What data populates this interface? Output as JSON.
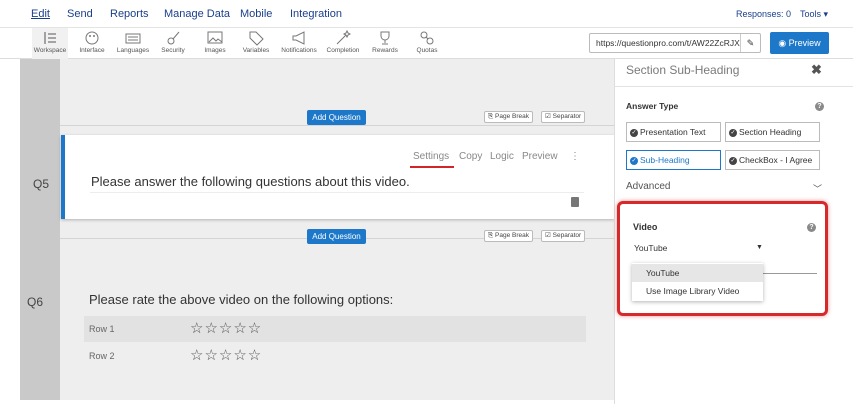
{
  "menu": {
    "items": [
      "Edit",
      "Send",
      "Reports",
      "Manage Data",
      "Mobile",
      "Integration"
    ],
    "responses": "Responses: 0",
    "tools": "Tools ▾"
  },
  "toolbar": {
    "tools": [
      {
        "label": "Workspace",
        "icon": "workspace-icon"
      },
      {
        "label": "Interface",
        "icon": "palette-icon"
      },
      {
        "label": "Languages",
        "icon": "keyboard-icon"
      },
      {
        "label": "Security",
        "icon": "guitar-icon"
      },
      {
        "label": "Images",
        "icon": "image-icon"
      },
      {
        "label": "Variables",
        "icon": "tag-icon"
      },
      {
        "label": "Notifications",
        "icon": "megaphone-icon"
      },
      {
        "label": "Completion",
        "icon": "magic-wand-icon"
      },
      {
        "label": "Rewards",
        "icon": "trophy-icon"
      },
      {
        "label": "Quotas",
        "icon": "quota-icon"
      }
    ],
    "url": "https://questionpro.com/t/AW22ZcRJX",
    "preview": "◉ Preview"
  },
  "canvas": {
    "add_question": "Add Question",
    "page_break": "Page Break",
    "separator": "Separator",
    "q5": {
      "number": "Q5",
      "text": "Please answer the following questions about this video.",
      "actions": [
        "Settings",
        "Copy",
        "Logic",
        "Preview",
        "⋮"
      ]
    },
    "q6": {
      "number": "Q6",
      "text": "Please rate the above video on the following options:",
      "rows": [
        {
          "label": "Row 1",
          "stars": "☆☆☆☆☆"
        },
        {
          "label": "Row 2",
          "stars": "☆☆☆☆☆"
        }
      ]
    }
  },
  "panel": {
    "title": "Section Sub-Heading",
    "close": "✖",
    "answer_type_label": "Answer Type",
    "answer_types": [
      "Presentation Text",
      "Section Heading",
      "Sub-Heading",
      "CheckBox - I Agree"
    ],
    "selected_answer_type": "Sub-Heading",
    "advanced": "Advanced",
    "video_label": "Video",
    "video_value": "YouTube",
    "video_options": [
      "YouTube",
      "Use Image Library Video"
    ]
  },
  "colors": {
    "accent": "#1d78c9",
    "highlight": "#d6292c",
    "gutter": "#c9c9c9"
  }
}
